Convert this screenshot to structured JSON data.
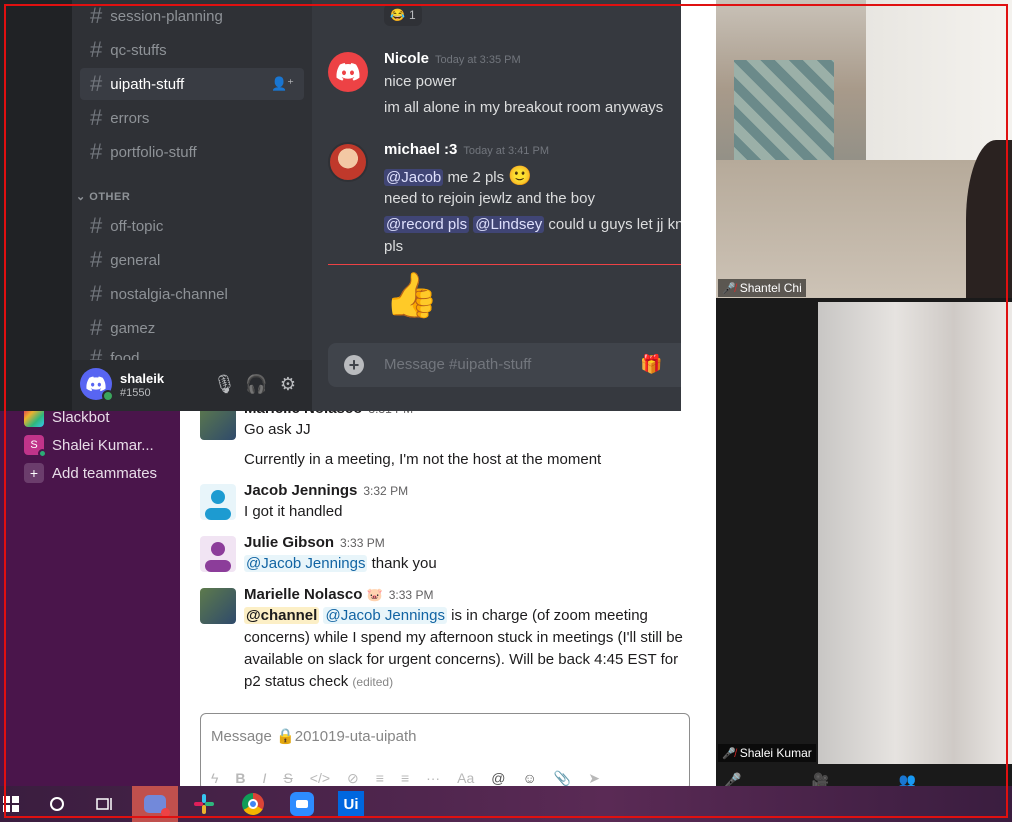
{
  "slack": {
    "sidebar": {
      "items": [
        {
          "label": "Slackbot",
          "icon": "slackbot-icon"
        },
        {
          "label": "Shalei Kumar...",
          "icon": "user-avatar"
        },
        {
          "label": "Add teammates",
          "icon": "plus-icon"
        }
      ]
    },
    "messages": [
      {
        "name": "Marielle Nolasco",
        "time": "3:31 PM",
        "lines": [
          "Go ask JJ",
          "Currently in a meeting, I'm not the host at the moment"
        ]
      },
      {
        "name": "Jacob Jennings",
        "time": "3:32 PM",
        "lines": [
          "I got it handled"
        ]
      },
      {
        "name": "Julie Gibson",
        "time": "3:33 PM",
        "mention": "@Jacob Jennings",
        "text": "thank you"
      },
      {
        "name": "Marielle Nolasco",
        "time": "3:33 PM",
        "channel_mention": "@channel",
        "mention": "@Jacob Jennings",
        "line1_tail": "is in charge (of zoom meeting",
        "line2": "concerns) while I spend my afternoon stuck in meetings (I'll still be",
        "line3": "available on slack for urgent concerns). Will be back 4:45 EST for",
        "line4": "p2 status check",
        "edited": "(edited)"
      }
    ],
    "composer": {
      "placeholder": "Message",
      "channel": "201019-uta-uipath"
    }
  },
  "discord": {
    "channels": [
      "session-planning",
      "qc-stuffs",
      "uipath-stuff",
      "errors",
      "portfolio-stuff"
    ],
    "active_channel": "uipath-stuff",
    "category": "OTHER",
    "other_channels": [
      "off-topic",
      "general",
      "nostalgia-channel",
      "gamez",
      "food"
    ],
    "user": {
      "name": "shaleik",
      "tag": "#1550"
    },
    "reaction_count": "1",
    "messages": [
      {
        "name": "Nicole",
        "time": "Today at 3:35 PM",
        "lines": [
          "nice power",
          "im all alone in my breakout room anyways"
        ]
      },
      {
        "name": "michael :3",
        "time": "Today at 3:41 PM",
        "m1": "@Jacob",
        "t1": "me 2 pls",
        "line2": "need to rejoin jewlz and the boy",
        "m2": "@record pls",
        "m3": "@Lindsey",
        "t3": "could u guys let jj know",
        "line4": "pls"
      }
    ],
    "input_placeholder": "Message #uipath-stuff"
  },
  "zoom": {
    "participants": [
      {
        "name": "Shantel Chi"
      },
      {
        "name": "Shalei Kumar"
      }
    ]
  }
}
